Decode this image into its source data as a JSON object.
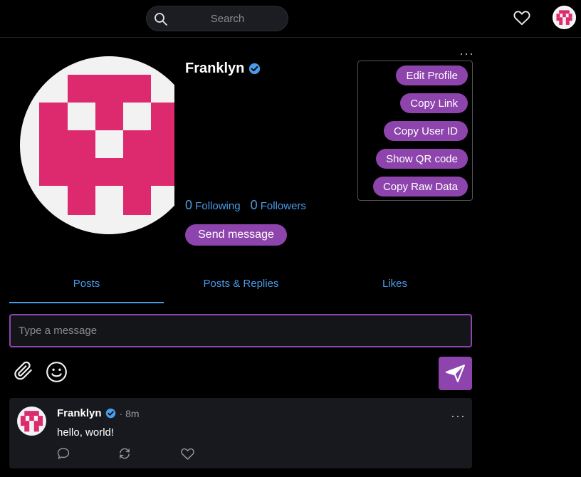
{
  "header": {
    "search_placeholder": "Search"
  },
  "profile": {
    "name": "Franklyn",
    "following_count": "0",
    "following_label": "Following",
    "followers_count": "0",
    "followers_label": "Followers",
    "send_message_label": "Send message"
  },
  "menu": {
    "items": [
      "Edit Profile",
      "Copy Link",
      "Copy User ID",
      "Show QR code",
      "Copy Raw Data"
    ]
  },
  "tabs": [
    {
      "label": "Posts",
      "active": true
    },
    {
      "label": "Posts & Replies",
      "active": false
    },
    {
      "label": "Likes",
      "active": false
    }
  ],
  "composer": {
    "placeholder": "Type a message"
  },
  "post": {
    "author": "Franklyn",
    "time": "· 8m",
    "body": "hello, world!"
  },
  "colors": {
    "accent": "#8e44ad",
    "link": "#4a9be8",
    "verified": "#4a9be8",
    "avatar_pink": "#dd2a6e"
  },
  "icons": [
    "search-icon",
    "heart-icon",
    "verified-icon",
    "more-icon",
    "paperclip-icon",
    "smiley-icon",
    "send-icon",
    "reply-icon",
    "repost-icon",
    "like-icon"
  ]
}
